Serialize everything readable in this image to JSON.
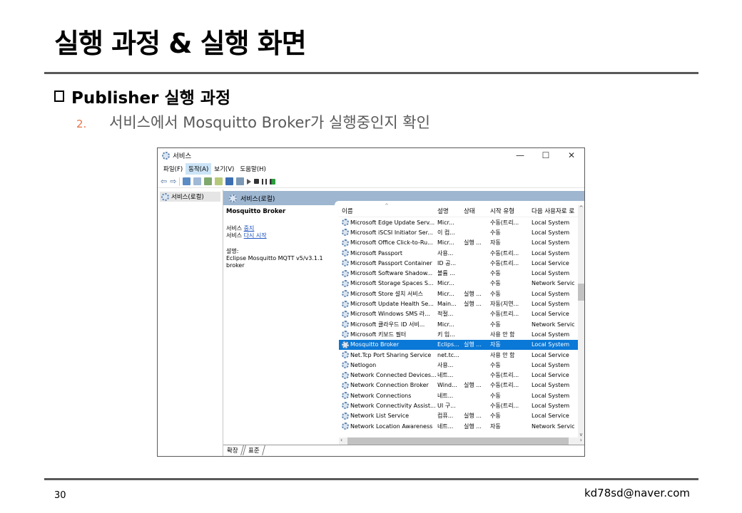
{
  "slide": {
    "title": "실행 과정 & 실행 화면",
    "section_heading": "Publisher 실행 과정",
    "step_number": "2.",
    "step_text": "서비스에서 Mosquitto Broker가 실행중인지 확인",
    "page_number": "30",
    "email": "kd78sd@naver.com"
  },
  "window": {
    "title": "서비스",
    "controls": {
      "minimize": "—",
      "maximize": "☐",
      "close": "✕"
    },
    "menu": [
      "파일(F)",
      "동작(A)",
      "보기(V)",
      "도움말(H)"
    ],
    "menu_active_index": 1,
    "tree_item": "서비스(로컬)",
    "panel_header": "서비스(로컬)",
    "detail": {
      "service_name": "Mosquitto Broker",
      "stop_prefix": "서비스 ",
      "stop_link": "중지",
      "restart_prefix": "서비스 ",
      "restart_link": "다시 시작",
      "description_label": "설명:",
      "description": "Eclipse Mosquitto MQTT v5/v3.1.1 broker"
    },
    "columns": {
      "name": "이름",
      "description": "설명",
      "status": "상태",
      "startup": "시작 유형",
      "logon": "다음 사용자로 로"
    },
    "rows": [
      {
        "name": "Microsoft Edge Update Serv...",
        "desc": "Micr...",
        "status": "",
        "startup": "수동(트리...",
        "logon": "Local System"
      },
      {
        "name": "Microsoft iSCSI Initiator Ser...",
        "desc": "이 컴...",
        "status": "",
        "startup": "수동",
        "logon": "Local System"
      },
      {
        "name": "Microsoft Office Click-to-Ru...",
        "desc": "Micr...",
        "status": "실행 ...",
        "startup": "자동",
        "logon": "Local System"
      },
      {
        "name": "Microsoft Passport",
        "desc": "사용...",
        "status": "",
        "startup": "수동(트리...",
        "logon": "Local System"
      },
      {
        "name": "Microsoft Passport Container",
        "desc": "ID 공...",
        "status": "",
        "startup": "수동(트리...",
        "logon": "Local Service"
      },
      {
        "name": "Microsoft Software Shadow...",
        "desc": "볼륨 ...",
        "status": "",
        "startup": "수동",
        "logon": "Local System"
      },
      {
        "name": "Microsoft Storage Spaces S...",
        "desc": "Micr...",
        "status": "",
        "startup": "수동",
        "logon": "Network Service"
      },
      {
        "name": "Microsoft Store 설치 서비스",
        "desc": "Micr...",
        "status": "실행 ...",
        "startup": "수동",
        "logon": "Local System"
      },
      {
        "name": "Microsoft Update Health Se...",
        "desc": "Main...",
        "status": "실행 ...",
        "startup": "자동(지연...",
        "logon": "Local System"
      },
      {
        "name": "Microsoft Windows SMS 라...",
        "desc": "적절...",
        "status": "",
        "startup": "수동(트리...",
        "logon": "Local Service"
      },
      {
        "name": "Microsoft 클라우드 ID 서비...",
        "desc": "Micr...",
        "status": "",
        "startup": "수동",
        "logon": "Network Service"
      },
      {
        "name": "Microsoft 키보드 필터",
        "desc": "키 입...",
        "status": "",
        "startup": "사용 안 함",
        "logon": "Local System"
      },
      {
        "name": "Mosquitto Broker",
        "desc": "Eclips...",
        "status": "실행 ...",
        "startup": "자동",
        "logon": "Local System",
        "selected": true
      },
      {
        "name": "Net.Tcp Port Sharing Service",
        "desc": "net.tc...",
        "status": "",
        "startup": "사용 안 함",
        "logon": "Local Service"
      },
      {
        "name": "Netlogon",
        "desc": "사용...",
        "status": "",
        "startup": "수동",
        "logon": "Local System"
      },
      {
        "name": "Network Connected Devices...",
        "desc": "네트...",
        "status": "",
        "startup": "수동(트리...",
        "logon": "Local Service"
      },
      {
        "name": "Network Connection Broker",
        "desc": "Wind...",
        "status": "실행 ...",
        "startup": "수동(트리...",
        "logon": "Local System"
      },
      {
        "name": "Network Connections",
        "desc": "네트...",
        "status": "",
        "startup": "수동",
        "logon": "Local System"
      },
      {
        "name": "Network Connectivity Assist...",
        "desc": "UI 구...",
        "status": "",
        "startup": "수동(트리...",
        "logon": "Local System"
      },
      {
        "name": "Network List Service",
        "desc": "컴퓨...",
        "status": "실행 ...",
        "startup": "수동",
        "logon": "Local Service"
      },
      {
        "name": "Network Location Awareness",
        "desc": "네트...",
        "status": "실행 ...",
        "startup": "자동",
        "logon": "Network Service"
      }
    ],
    "tabs": [
      "확장",
      "표준"
    ]
  },
  "colors": {
    "rule": "#595959",
    "step_number": "#e8754a",
    "selection": "#0a78d7",
    "panel_header": "#9eb6d0",
    "link": "#1a4fbd"
  },
  "icons": {
    "service": "gear-icon",
    "back": "back-arrow-icon",
    "forward": "forward-arrow-icon",
    "start": "play-icon",
    "stop": "stop-icon",
    "pause": "pause-icon",
    "restart": "restart-icon"
  }
}
